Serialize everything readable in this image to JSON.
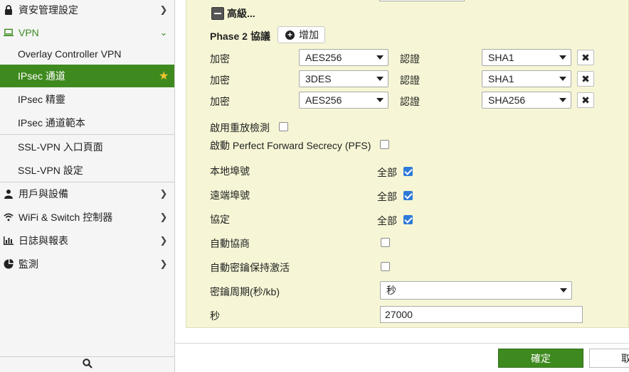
{
  "sidebar": {
    "items": [
      {
        "label": "資安管理設定",
        "icon": "lock-icon"
      },
      {
        "label": "VPN",
        "icon": "laptop-icon"
      },
      {
        "label": "Overlay Controller VPN"
      },
      {
        "label": "IPsec 通道",
        "icon": "star-icon"
      },
      {
        "label": "IPsec 精靈"
      },
      {
        "label": "IPsec 通道範本"
      },
      {
        "label": "SSL-VPN 入口頁面"
      },
      {
        "label": "SSL-VPN 設定"
      },
      {
        "label": "用戶與設備",
        "icon": "user-icon"
      },
      {
        "label": "WiFi & Switch 控制器",
        "icon": "wifi-icon"
      },
      {
        "label": "日誌與報表",
        "icon": "bar-chart-icon"
      },
      {
        "label": "監測",
        "icon": "pie-chart-icon"
      }
    ],
    "search_icon": "search-icon"
  },
  "phase2": {
    "advanced_label": "高級...",
    "title": "Phase 2 協議",
    "add_label": "增加",
    "proposals": [
      {
        "enc_label": "加密",
        "enc": "AES256",
        "auth_label": "認證",
        "auth": "SHA1"
      },
      {
        "enc_label": "加密",
        "enc": "3DES",
        "auth_label": "認證",
        "auth": "SHA1"
      },
      {
        "enc_label": "加密",
        "enc": "AES256",
        "auth_label": "認證",
        "auth": "SHA256"
      }
    ],
    "replay_label": "啟用重放檢測",
    "pfs_label": "啟動 Perfect Forward Secrecy (PFS)",
    "local_port_label": "本地埠號",
    "remote_port_label": "遠端埠號",
    "protocol_label": "協定",
    "all_label": "全部",
    "autonego_label": "自動協商",
    "keepalive_label": "自動密鑰保持激活",
    "key_lifetime_label": "密鑰周期(秒/kb)",
    "key_lifetime_value": "秒",
    "seconds_label": "秒",
    "seconds_value": "27000"
  },
  "footer": {
    "ok_label": "確定",
    "cancel_label": "取消"
  },
  "colors": {
    "accent": "#3f8a1f",
    "panel_bg": "#f6f6d6",
    "checkbox": "#2f7ad8"
  }
}
